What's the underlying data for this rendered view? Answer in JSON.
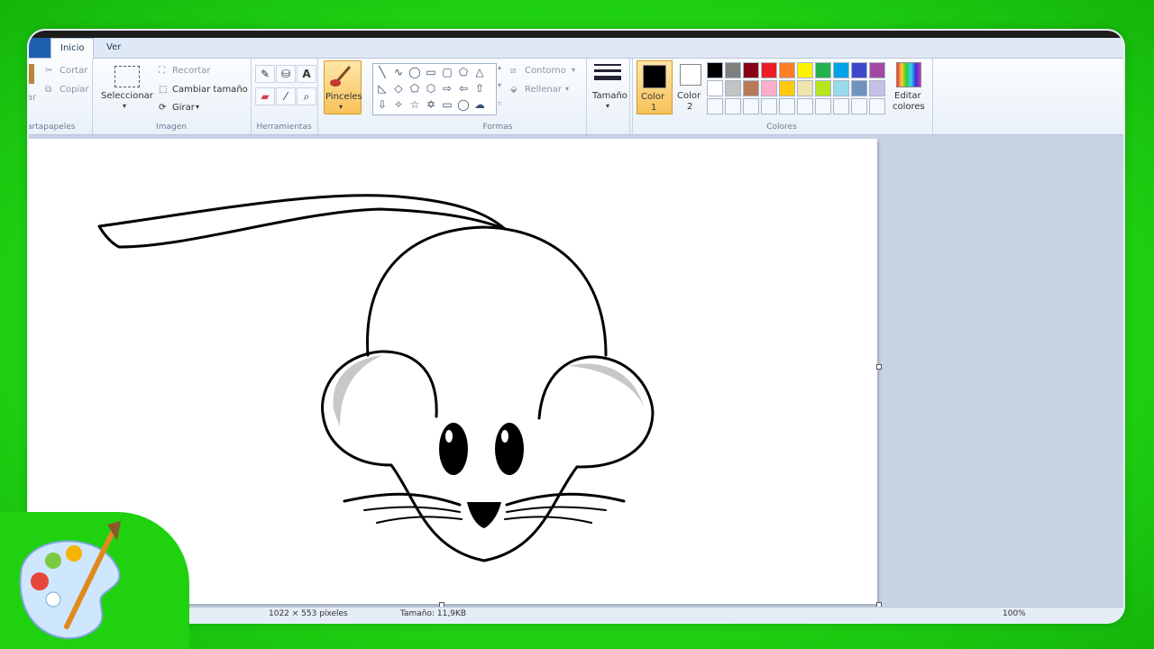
{
  "tabs": [
    {
      "label": "Inicio"
    },
    {
      "label": "Ver"
    }
  ],
  "clipboard": {
    "cut": "Cortar",
    "copy": "Copiar",
    "paste": "ar",
    "label": "artapapeles"
  },
  "image": {
    "select": "Seleccionar",
    "crop": "Recortar",
    "resize": "Cambiar tamaño",
    "rotate": "Girar",
    "label": "Imagen"
  },
  "tools": {
    "label": "Herramientas",
    "text_tool": "A"
  },
  "brushes": {
    "label": "Pinceles"
  },
  "shapes": {
    "outline": "Contorno",
    "fill": "Rellenar",
    "label": "Formas"
  },
  "size": {
    "label": "Tamaño"
  },
  "colors": {
    "color1": "Color",
    "color1_num": "1",
    "color2": "Color",
    "color2_num": "2",
    "edit": "Editar",
    "edit2": "colores",
    "label": "Colores",
    "palette_row1": [
      "#000000",
      "#7f7f7f",
      "#880015",
      "#ed1c24",
      "#ff7f27",
      "#fff200",
      "#22b14c",
      "#00a2e8",
      "#3f48cc",
      "#a349a4"
    ],
    "palette_row2": [
      "#ffffff",
      "#c3c3c3",
      "#b97a57",
      "#ffaec9",
      "#ffc90e",
      "#efe4b0",
      "#b5e61d",
      "#99d9ea",
      "#7092be",
      "#c8bfe7"
    ]
  },
  "status": {
    "dimensions": "1022 × 553 píxeles",
    "size": "Tamaño: 11,9KB",
    "zoom": "100%"
  }
}
